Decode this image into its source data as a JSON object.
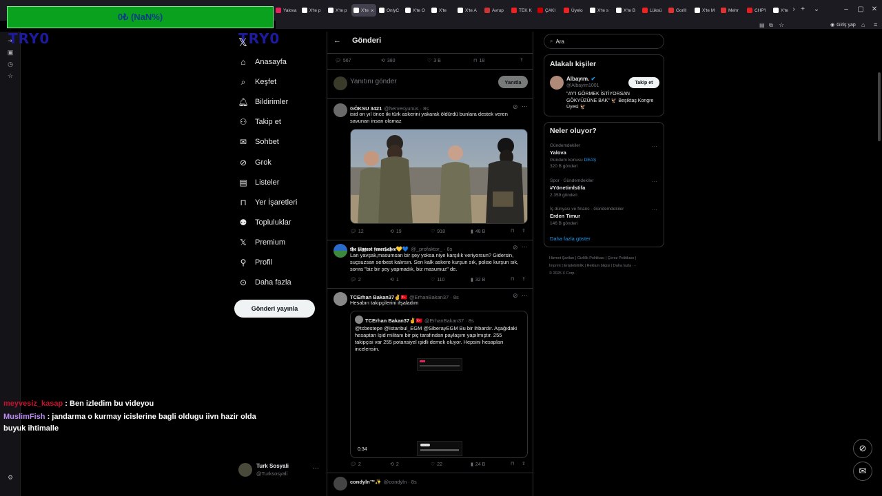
{
  "browser": {
    "tabs": [
      {
        "label": "Yalova",
        "color": "#e0245e"
      },
      {
        "label": "X'te p",
        "color": "#fff"
      },
      {
        "label": "X'te p",
        "color": "#fff"
      },
      {
        "label": "X'te",
        "color": "#fff",
        "active": true
      },
      {
        "label": "OnlyC",
        "color": "#fff"
      },
      {
        "label": "X'te O",
        "color": "#fff"
      },
      {
        "label": "X'te",
        "color": "#fff"
      },
      {
        "label": "X'te A",
        "color": "#fff"
      },
      {
        "label": "Avrup",
        "color": "#c33"
      },
      {
        "label": "TEK K",
        "color": "#e22"
      },
      {
        "label": "ÇAKI",
        "color": "#c00"
      },
      {
        "label": "Üyelo",
        "color": "#e22"
      },
      {
        "label": "X'te s",
        "color": "#fff"
      },
      {
        "label": "X'te B",
        "color": "#fff"
      },
      {
        "label": "Lüksü",
        "color": "#e22"
      },
      {
        "label": "Gorill",
        "color": "#d33"
      },
      {
        "label": "X'te M",
        "color": "#fff"
      },
      {
        "label": "Mehr",
        "color": "#d33"
      },
      {
        "label": "CHP'l",
        "color": "#e02020"
      },
      {
        "label": "X'te",
        "color": "#fff"
      }
    ],
    "signin_label": "Giriş yap"
  },
  "overlay": {
    "bar_text": "0₺ (NaN%)",
    "logo_text": "TRY0"
  },
  "chat": [
    {
      "user": "meyvesiz_kasap",
      "user_color": "#c8102e",
      "message": " : Ben izledim bu videyou"
    },
    {
      "user": "MuslimFish",
      "user_color": "#b98cf0",
      "message": " : jandarma o kurmay icislerine bagli oldugu iivn hazir olda buyuk ihtimalle"
    }
  ],
  "nav": {
    "items": [
      {
        "icon": "home-icon",
        "label": "Anasayfa"
      },
      {
        "icon": "search-icon",
        "label": "Keşfet"
      },
      {
        "icon": "bell-icon",
        "label": "Bildirimler"
      },
      {
        "icon": "follow-icon",
        "label": "Takip et"
      },
      {
        "icon": "mail-icon",
        "label": "Sohbet"
      },
      {
        "icon": "grok-icon",
        "label": "Grok"
      },
      {
        "icon": "list-icon",
        "label": "Listeler"
      },
      {
        "icon": "bookmark-icon",
        "label": "Yer İşaretleri"
      },
      {
        "icon": "communities-icon",
        "label": "Topluluklar"
      },
      {
        "icon": "x-icon",
        "label": "Premium"
      },
      {
        "icon": "profile-icon",
        "label": "Profil"
      },
      {
        "icon": "more-icon",
        "label": "Daha fazla"
      }
    ],
    "post_button": "Gönderi yayınla",
    "account_name": "Turk Sosyali",
    "account_handle": "@Turksosyali"
  },
  "main": {
    "title": "Gönderi",
    "stats": {
      "replies": "567",
      "reposts": "380",
      "likes": "3 B",
      "bookmarks": "18"
    },
    "reply_placeholder": "Yanıtını gönder",
    "reply_button": "Yanıtla",
    "posts": [
      {
        "name": "GÖKSU 3421",
        "handle": "@hervesyunus · 8s",
        "text": "isid on yıl önce iki türk askerini yakarak öldürdü bunlara destek veren savunan insan olamaz",
        "stats": {
          "replies": "12",
          "reposts": "19",
          "likes": "918",
          "views": "48 B"
        }
      },
      {
        "name": "𝖙𝖍𝖊 𝖇𝖎𝖌𝖌𝖊𝖘𝖙 𝖋𝖊𝖓𝖊𝖗𝖇𝖆𝖍𝖈𝖊💛💙",
        "handle": "@_profaktor_ · 8s",
        "text": "Lan yavşak,masumsan bir şey yoksa niye karşılık veriyorsun? Gidersin, suçsuzsan serbest kalırsın. Sen kalk askere kurşun sık, polise kurşun sık, sonra \"biz bir şey yapmadık, biz masumuz\" de.",
        "stats": {
          "replies": "2",
          "reposts": "1",
          "likes": "110",
          "views": "32 B"
        }
      },
      {
        "name": "TCErhan Bakan37✌️🇹🇷",
        "handle": "@ErhanBakan37 · 8s",
        "text": "Hesabın takipçilerini ifşaladım",
        "quote": {
          "name": "TCErhan Bakan37✌️🇹🇷",
          "handle": "@ErhanBakan37 · 8s",
          "text": "@tcbestepe @Istanbul_EGM @SiberayEGM Bu bir ihbardır. Aşağıdaki hesaptan Işid militanı bir piç tarafından paylaşım yapılmıştır. 255 takipçisi var 255 potansiyel ışidli demek oluyor. Hepsini hesapları incelensin.",
          "video_time": "0:34"
        },
        "stats": {
          "replies": "2",
          "reposts": "2",
          "likes": "22",
          "views": "24 B"
        }
      },
      {
        "name": "condyln™✨",
        "handle": "@condyln · 8s"
      }
    ]
  },
  "right": {
    "search_placeholder": "Ara",
    "related": {
      "title": "Alakalı kişiler",
      "name": "Albayım.",
      "handle": "@Albayim1001",
      "follow": "Takip et",
      "bio": "\"AY'I GÖRMEK İSTİYORSAN GÖKYÜZÜNE BAK\" 🦅 Beşiktaş Kongre Üyesi 🦅"
    },
    "trends": {
      "title": "Neler oluyor?",
      "items": [
        {
          "context": "Gündemdekiler",
          "topic": "Yalova",
          "extra_label": "Gündem konusu",
          "extra_link": "DEAŞ",
          "count": "320 B gönderi"
        },
        {
          "context": "Spor · Gündemdekiler",
          "topic": "#Yönetimİstifa",
          "count": "2.359 gönderi"
        },
        {
          "context": "İş dünyası ve finans · Gündemdekiler",
          "topic": "Erden Timur",
          "count": "146 B gönderi"
        }
      ],
      "show_more": "Daha fazla göster"
    },
    "footer": {
      "line1": "Hizmet Şartları | Gizlilik Politikası | Çerez Politikası |",
      "line2": "Imprint | Erişilebilirlik | Reklam bilgisi | Daha fazla ···",
      "line3": "© 2025 X Corp."
    }
  }
}
